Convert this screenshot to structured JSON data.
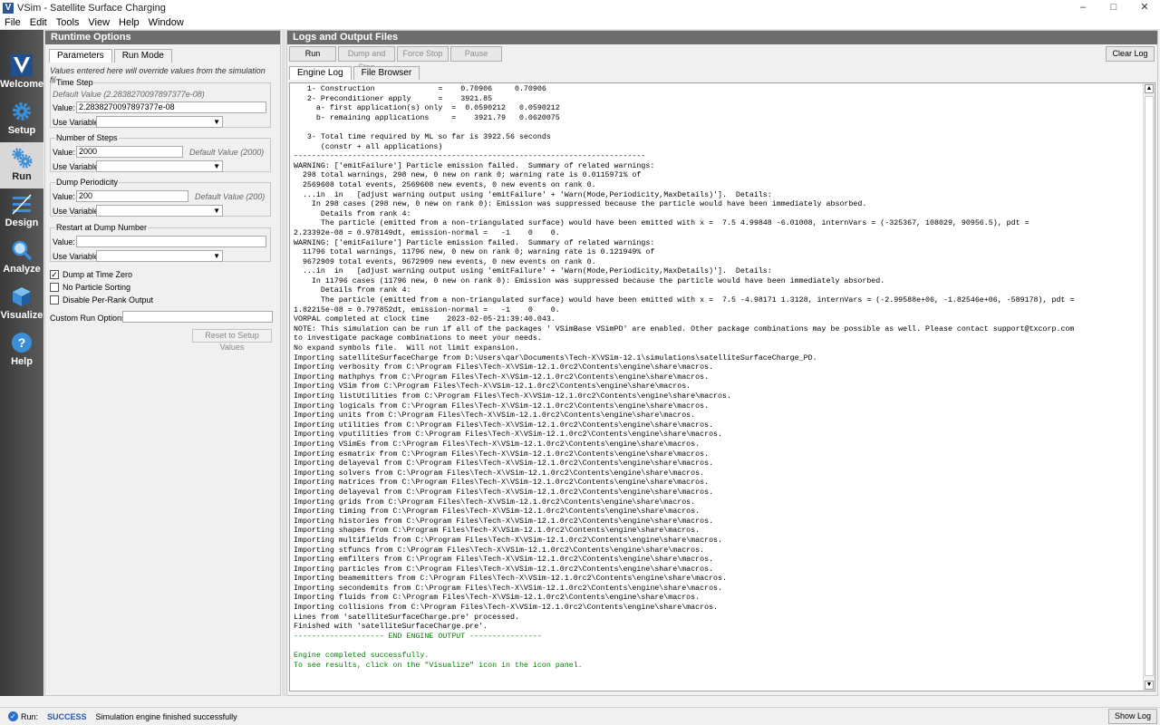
{
  "window": {
    "title": "VSim - Satellite Surface Charging",
    "icon_letter": "V",
    "minimize": "–",
    "maximize": "□",
    "close": "✕"
  },
  "menu": {
    "items": [
      "File",
      "Edit",
      "Tools",
      "View",
      "Help",
      "Window"
    ]
  },
  "nav": {
    "items": [
      {
        "label": "Welcome",
        "icon": "vsim-logo-icon"
      },
      {
        "label": "Setup",
        "icon": "gear-icon"
      },
      {
        "label": "Run",
        "icon": "gears-icon"
      },
      {
        "label": "Design",
        "icon": "design-icon"
      },
      {
        "label": "Analyze",
        "icon": "magnifier-icon"
      },
      {
        "label": "Visualize",
        "icon": "cube-icon"
      },
      {
        "label": "Help",
        "icon": "question-icon"
      }
    ],
    "active": "Run"
  },
  "runtime": {
    "header": "Runtime Options",
    "tabs": [
      "Parameters",
      "Run Mode"
    ],
    "subtitle": "Values entered here will override values from the simulation file.",
    "time_step": {
      "title": "Time Step",
      "default": "Default Value (2.2838270097897377e-08)",
      "value_label": "Value:",
      "value": "2.2838270097897377e-08",
      "use_var_label": "Use Variable:"
    },
    "num_steps": {
      "title": "Number of Steps",
      "value_label": "Value:",
      "value": "2000",
      "default": "Default Value (2000)",
      "use_var_label": "Use Variable:"
    },
    "dump_periodicity": {
      "title": "Dump Periodicity",
      "value_label": "Value:",
      "value": "200",
      "default": "Default Value (200)",
      "use_var_label": "Use Variable:"
    },
    "restart": {
      "title": "Restart at Dump Number",
      "value_label": "Value:",
      "value": "",
      "use_var_label": "Use Variable:"
    },
    "checkboxes": [
      {
        "label": "Dump at Time Zero",
        "checked": true
      },
      {
        "label": "No Particle Sorting",
        "checked": false
      },
      {
        "label": "Disable Per-Rank Output",
        "checked": false
      }
    ],
    "custom_run_options_label": "Custom Run Options",
    "custom_run_options_value": "",
    "reset_button": "Reset to Setup Values"
  },
  "logs": {
    "header": "Logs and Output Files",
    "buttons": {
      "run": "Run",
      "dump_and_stop": "Dump and Stop",
      "force_stop": "Force Stop",
      "pause": "Pause",
      "clear_log": "Clear Log"
    },
    "tabs": [
      "Engine Log",
      "File Browser"
    ],
    "lines": [
      {
        "t": "   1- Construction              =    0.70906     0.70906",
        "c": ""
      },
      {
        "t": "   2- Preconditioner apply      =    3921.85",
        "c": ""
      },
      {
        "t": "     a- first application(s) only  =  0.0590212   0.0590212",
        "c": ""
      },
      {
        "t": "     b- remaining applications     =    3921.79   0.0620075",
        "c": ""
      },
      {
        "t": "",
        "c": ""
      },
      {
        "t": "   3- Total time required by ML so far is 3922.56 seconds",
        "c": ""
      },
      {
        "t": "      (constr + all applications)",
        "c": ""
      },
      {
        "t": "------------------------------------------------------------------------------",
        "c": ""
      },
      {
        "t": "WARNING: ['emitFailure'] Particle emission failed.  Summary of related warnings:",
        "c": ""
      },
      {
        "t": "  298 total warnings, 298 new, 0 new on rank 0; warning rate is 0.0115971% of",
        "c": ""
      },
      {
        "t": "  2569608 total events, 2569608 new events, 0 new events on rank 0.",
        "c": ""
      },
      {
        "t": "  ...in  in   [adjust warning output using 'emitFailure' + 'Warn(Mode,Periodicity,MaxDetails)'].  Details:",
        "c": ""
      },
      {
        "t": "    In 298 cases (298 new, 0 new on rank 0): Emission was suppressed because the particle would have been immediately absorbed.",
        "c": ""
      },
      {
        "t": "      Details from rank 4:",
        "c": ""
      },
      {
        "t": "      The particle (emitted from a non-triangulated surface) would have been emitted with x =  7.5 4.99848 -6.01008, internVars = (-325367, 108029, 90956.5), pdt =",
        "c": ""
      },
      {
        "t": "2.23392e-08 = 0.978149dt, emission-normal =   -1    0    0.",
        "c": ""
      },
      {
        "t": "WARNING: ['emitFailure'] Particle emission failed.  Summary of related warnings:",
        "c": ""
      },
      {
        "t": "  11796 total warnings, 11796 new, 0 new on rank 0; warning rate is 0.121949% of",
        "c": ""
      },
      {
        "t": "  9672909 total events, 9672909 new events, 0 new events on rank 0.",
        "c": ""
      },
      {
        "t": "  ...in  in   [adjust warning output using 'emitFailure' + 'Warn(Mode,Periodicity,MaxDetails)'].  Details:",
        "c": ""
      },
      {
        "t": "    In 11796 cases (11796 new, 0 new on rank 0): Emission was suppressed because the particle would have been immediately absorbed.",
        "c": ""
      },
      {
        "t": "      Details from rank 4:",
        "c": ""
      },
      {
        "t": "      The particle (emitted from a non-triangulated surface) would have been emitted with x =  7.5 -4.98171 1.3128, internVars = (-2.99588e+06, -1.82546e+06, -589178), pdt =",
        "c": ""
      },
      {
        "t": "1.82215e-08 = 0.797852dt, emission-normal =   -1    0    0.",
        "c": ""
      },
      {
        "t": "VORPAL completed at clock time    2023-02-05-21:39:40.043.",
        "c": ""
      },
      {
        "t": "NOTE: This simulation can be run if all of the packages ' VSimBase VSimPD' are enabled. Other package combinations may be possible as well. Please contact support@txcorp.com",
        "c": ""
      },
      {
        "t": "to investigate package combinations to meet your needs.",
        "c": ""
      },
      {
        "t": "No expand symbols file.  Will not limit expansion.",
        "c": ""
      },
      {
        "t": "Importing satelliteSurfaceCharge from D:\\Users\\qar\\Documents\\Tech-X\\VSim-12.1\\simulations\\satelliteSurfaceCharge_PD.",
        "c": ""
      },
      {
        "t": "Importing verbosity from C:\\Program Files\\Tech-X\\VSim-12.1.0rc2\\Contents\\engine\\share\\macros.",
        "c": ""
      },
      {
        "t": "Importing mathphys from C:\\Program Files\\Tech-X\\VSim-12.1.0rc2\\Contents\\engine\\share\\macros.",
        "c": ""
      },
      {
        "t": "Importing VSim from C:\\Program Files\\Tech-X\\VSim-12.1.0rc2\\Contents\\engine\\share\\macros.",
        "c": ""
      },
      {
        "t": "Importing listUtilities from C:\\Program Files\\Tech-X\\VSim-12.1.0rc2\\Contents\\engine\\share\\macros.",
        "c": ""
      },
      {
        "t": "Importing logicals from C:\\Program Files\\Tech-X\\VSim-12.1.0rc2\\Contents\\engine\\share\\macros.",
        "c": ""
      },
      {
        "t": "Importing units from C:\\Program Files\\Tech-X\\VSim-12.1.0rc2\\Contents\\engine\\share\\macros.",
        "c": ""
      },
      {
        "t": "Importing utilities from C:\\Program Files\\Tech-X\\VSim-12.1.0rc2\\Contents\\engine\\share\\macros.",
        "c": ""
      },
      {
        "t": "Importing vputilities from C:\\Program Files\\Tech-X\\VSim-12.1.0rc2\\Contents\\engine\\share\\macros.",
        "c": ""
      },
      {
        "t": "Importing VSimEs from C:\\Program Files\\Tech-X\\VSim-12.1.0rc2\\Contents\\engine\\share\\macros.",
        "c": ""
      },
      {
        "t": "Importing esmatrix from C:\\Program Files\\Tech-X\\VSim-12.1.0rc2\\Contents\\engine\\share\\macros.",
        "c": ""
      },
      {
        "t": "Importing delayeval from C:\\Program Files\\Tech-X\\VSim-12.1.0rc2\\Contents\\engine\\share\\macros.",
        "c": ""
      },
      {
        "t": "Importing solvers from C:\\Program Files\\Tech-X\\VSim-12.1.0rc2\\Contents\\engine\\share\\macros.",
        "c": ""
      },
      {
        "t": "Importing matrices from C:\\Program Files\\Tech-X\\VSim-12.1.0rc2\\Contents\\engine\\share\\macros.",
        "c": ""
      },
      {
        "t": "Importing delayeval from C:\\Program Files\\Tech-X\\VSim-12.1.0rc2\\Contents\\engine\\share\\macros.",
        "c": ""
      },
      {
        "t": "Importing grids from C:\\Program Files\\Tech-X\\VSim-12.1.0rc2\\Contents\\engine\\share\\macros.",
        "c": ""
      },
      {
        "t": "Importing timing from C:\\Program Files\\Tech-X\\VSim-12.1.0rc2\\Contents\\engine\\share\\macros.",
        "c": ""
      },
      {
        "t": "Importing histories from C:\\Program Files\\Tech-X\\VSim-12.1.0rc2\\Contents\\engine\\share\\macros.",
        "c": ""
      },
      {
        "t": "Importing shapes from C:\\Program Files\\Tech-X\\VSim-12.1.0rc2\\Contents\\engine\\share\\macros.",
        "c": ""
      },
      {
        "t": "Importing multifields from C:\\Program Files\\Tech-X\\VSim-12.1.0rc2\\Contents\\engine\\share\\macros.",
        "c": ""
      },
      {
        "t": "Importing stfuncs from C:\\Program Files\\Tech-X\\VSim-12.1.0rc2\\Contents\\engine\\share\\macros.",
        "c": ""
      },
      {
        "t": "Importing emfilters from C:\\Program Files\\Tech-X\\VSim-12.1.0rc2\\Contents\\engine\\share\\macros.",
        "c": ""
      },
      {
        "t": "Importing particles from C:\\Program Files\\Tech-X\\VSim-12.1.0rc2\\Contents\\engine\\share\\macros.",
        "c": ""
      },
      {
        "t": "Importing beamemitters from C:\\Program Files\\Tech-X\\VSim-12.1.0rc2\\Contents\\engine\\share\\macros.",
        "c": ""
      },
      {
        "t": "Importing secondemits from C:\\Program Files\\Tech-X\\VSim-12.1.0rc2\\Contents\\engine\\share\\macros.",
        "c": ""
      },
      {
        "t": "Importing fluids from C:\\Program Files\\Tech-X\\VSim-12.1.0rc2\\Contents\\engine\\share\\macros.",
        "c": ""
      },
      {
        "t": "Importing collisions from C:\\Program Files\\Tech-X\\VSim-12.1.0rc2\\Contents\\engine\\share\\macros.",
        "c": ""
      },
      {
        "t": "Lines from 'satelliteSurfaceCharge.pre' processed.",
        "c": ""
      },
      {
        "t": "Finished with 'satelliteSurfaceCharge.pre'.",
        "c": ""
      },
      {
        "t": "-------------------- END ENGINE OUTPUT ----------------",
        "c": "green"
      },
      {
        "t": "",
        "c": ""
      },
      {
        "t": "Engine completed successfully.",
        "c": "green"
      },
      {
        "t": "To see results, click on the \"Visualize\" icon in the icon panel.",
        "c": "green"
      }
    ]
  },
  "status": {
    "label": "Run:",
    "badge": "SUCCESS",
    "message": "Simulation engine finished successfully",
    "show_log": "Show Log",
    "colors": {
      "success": "#2b56a6",
      "log_green": "#008000"
    }
  }
}
